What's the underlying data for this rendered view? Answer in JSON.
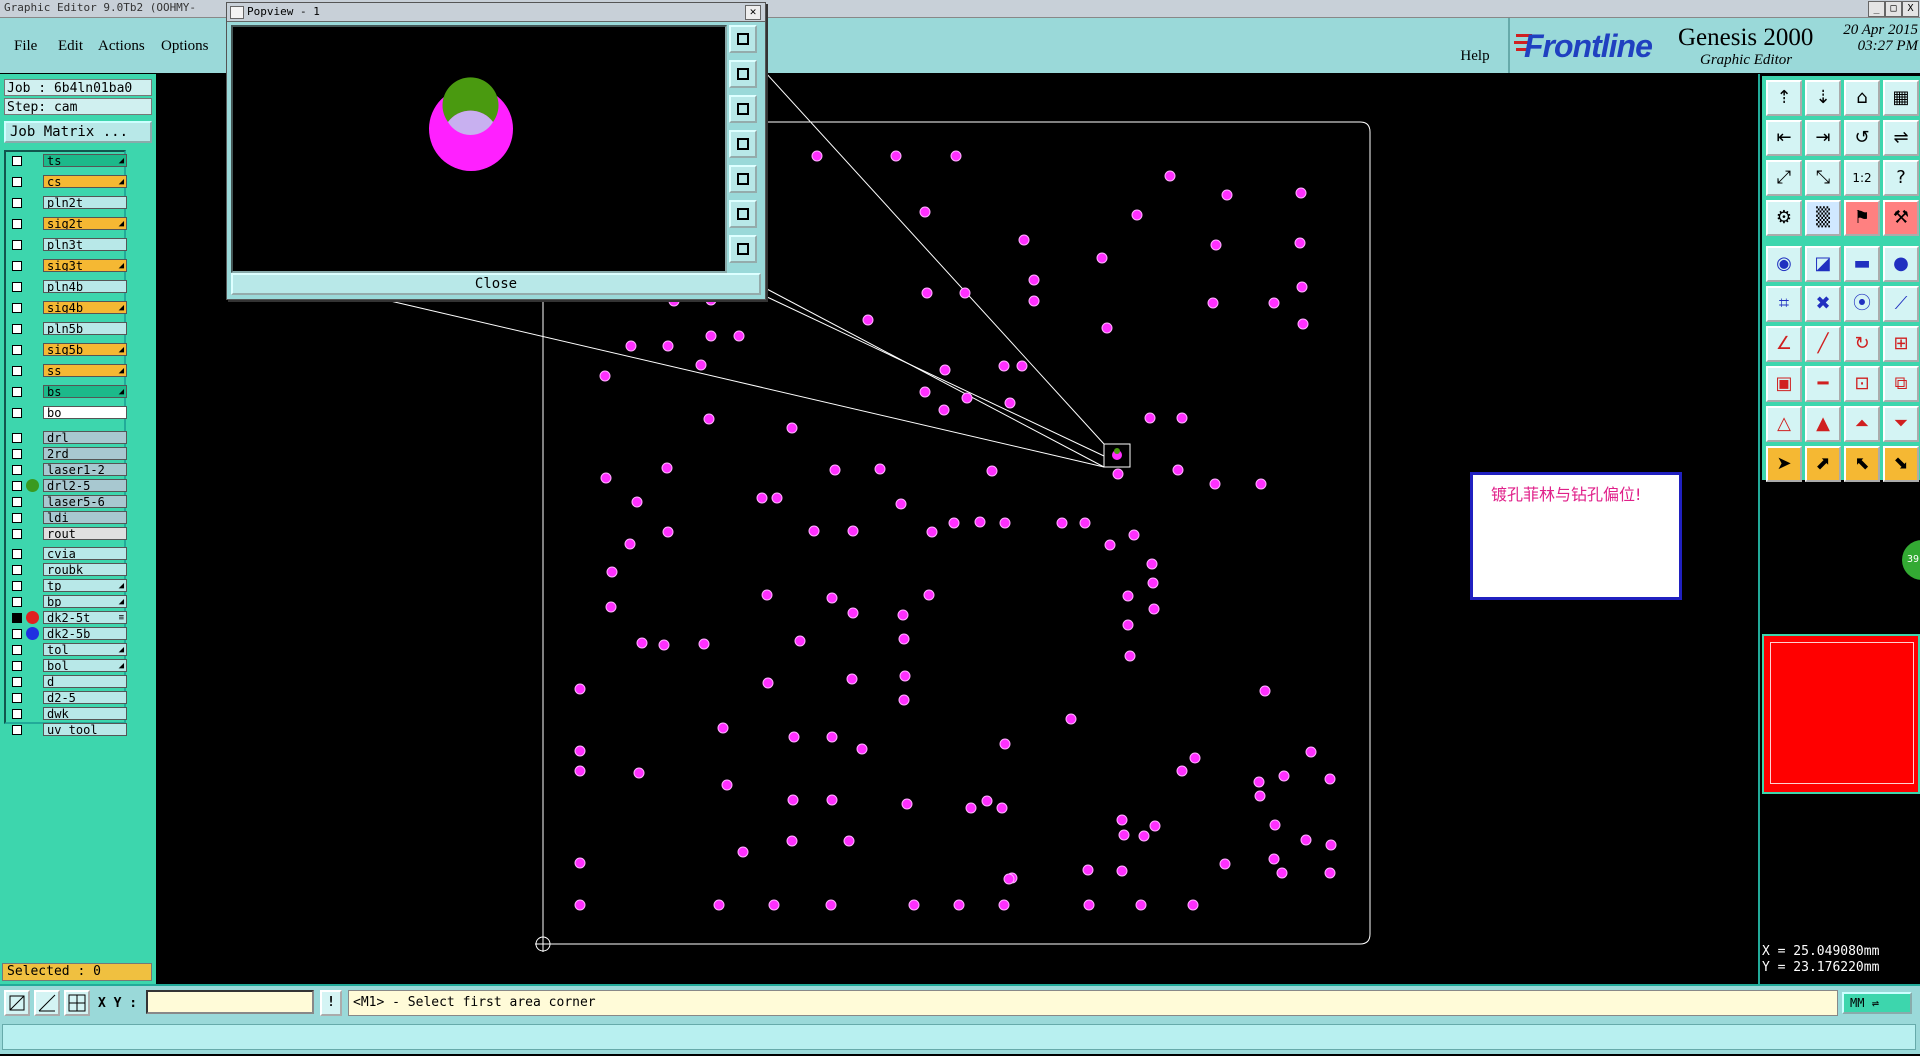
{
  "window": {
    "title": "Graphic Editor 9.0Tb2 (OOHMY-",
    "controls": [
      "_",
      "□",
      "X"
    ]
  },
  "menu": {
    "items": [
      "File",
      "Edit",
      "Actions",
      "Options"
    ],
    "help": "Help"
  },
  "brand": {
    "logo_main": "Frontline",
    "product": "Genesis 2000",
    "subtitle": "Graphic Editor",
    "date": "20 Apr 2015",
    "time": "03:27 PM"
  },
  "job": {
    "job_label": "Job : 6b4ln01ba0",
    "step_label": "Step: cam",
    "matrix_button": "Job Matrix ..."
  },
  "layers": [
    {
      "name": "ts",
      "color": "#1cb98a",
      "mark": "◢"
    },
    {
      "name": "cs",
      "color": "#f5b833",
      "mark": "◢"
    },
    {
      "name": "pln2t",
      "color": "#b8e8e8",
      "mark": ""
    },
    {
      "name": "sig2t",
      "color": "#f5b833",
      "mark": "◢"
    },
    {
      "name": "pln3t",
      "color": "#b8e8e8",
      "mark": ""
    },
    {
      "name": "sig3t",
      "color": "#f5b833",
      "mark": "◢"
    },
    {
      "name": "pln4b",
      "color": "#b8e8e8",
      "mark": ""
    },
    {
      "name": "sig4b",
      "color": "#f5b833",
      "mark": "◢"
    },
    {
      "name": "pln5b",
      "color": "#b8e8e8",
      "mark": ""
    },
    {
      "name": "sig5b",
      "color": "#f5b833",
      "mark": "◢"
    },
    {
      "name": "ss",
      "color": "#f5b833",
      "mark": "◢"
    },
    {
      "name": "bs",
      "color": "#1cb98a",
      "mark": "◢"
    },
    {
      "name": "bo",
      "color": "#ffffff",
      "mark": ""
    },
    {
      "name": "drl",
      "color": "#a8c8d0",
      "mark": ""
    },
    {
      "name": "2rd",
      "color": "#a8c8d0",
      "mark": ""
    },
    {
      "name": "laser1-2",
      "color": "#a8c8d0",
      "mark": ""
    },
    {
      "name": "drl2-5",
      "color": "#a8c8d0",
      "mark": "",
      "dot": "#3a9a20"
    },
    {
      "name": "laser5-6",
      "color": "#a8c8d0",
      "mark": ""
    },
    {
      "name": "ldi",
      "color": "#a8c8d0",
      "mark": ""
    },
    {
      "name": "rout",
      "color": "#e0e0e0",
      "mark": ""
    },
    {
      "name": "cvia",
      "color": "#b8e8e8",
      "mark": ""
    },
    {
      "name": "roubk",
      "color": "#b8e8e8",
      "mark": ""
    },
    {
      "name": "tp",
      "color": "#b8e8e8",
      "mark": "◢"
    },
    {
      "name": "bp",
      "color": "#b8e8e8",
      "mark": "◢"
    },
    {
      "name": "dk2-5t",
      "color": "#b8e8e8",
      "mark": "≡",
      "dot": "#e02020",
      "checked": true
    },
    {
      "name": "dk2-5b",
      "color": "#b8e8e8",
      "mark": "",
      "dot": "#2030e0"
    },
    {
      "name": "tol",
      "color": "#b8e8e8",
      "mark": "◢"
    },
    {
      "name": "bol",
      "color": "#b8e8e8",
      "mark": "◢"
    },
    {
      "name": "d",
      "color": "#b8e8e8",
      "mark": ""
    },
    {
      "name": "d2-5",
      "color": "#b8e8e8",
      "mark": ""
    },
    {
      "name": "dwk",
      "color": "#b8e8e8",
      "mark": ""
    },
    {
      "name": "uv_tool",
      "color": "#b8e8e8",
      "mark": ""
    }
  ],
  "selected": "Selected : 0",
  "popview": {
    "title": "Popview - 1",
    "close_label": "Close"
  },
  "note": {
    "text": "镀孔菲林与钻孔偏位!"
  },
  "coords": {
    "x": "X = 25.049080mm",
    "y": "Y = 23.176220mm"
  },
  "side_tab": "39",
  "status": {
    "xy_label": "X Y :",
    "xy_value": "",
    "prompt": "<M1> - Select first area corner",
    "units": "MM"
  },
  "tool_icons": [
    "layer-in-icon",
    "layer-out-icon",
    "home-icon",
    "grid-icon",
    "move-left-icon",
    "move-right-icon",
    "snap-icon",
    "redo-line-icon",
    "fit-x-icon",
    "fit-y-icon",
    "scale-1-2-icon",
    "help-query-icon",
    "graphics-icon",
    "tile-icon",
    "red-settings-icon",
    "red-tools-icon",
    "pad-select-icon",
    "cross-select-icon",
    "tape-measure-icon",
    "dot-icon",
    "net-icon",
    "cross-x-icon",
    "pins-icon",
    "link-icon",
    "angle-icon",
    "line-icon",
    "arc-icon",
    "dim-icon",
    "pad-add-icon",
    "line-red-icon",
    "spacing-icon",
    "copy-icon",
    "triangle-icon",
    "triangle-up-icon",
    "triangle-mark-icon",
    "triangle-cut-icon",
    "pointer-icon",
    "pointer-box-icon",
    "pointer-highlight-icon",
    "pointer-route-icon"
  ],
  "colors": {
    "panel_teal": "#3dd6ad",
    "menu_cyan": "#9ad9d9",
    "pad_magenta": "#ff30ff",
    "board_outline": "#ffffff",
    "minimap_red": "#ff0000"
  }
}
